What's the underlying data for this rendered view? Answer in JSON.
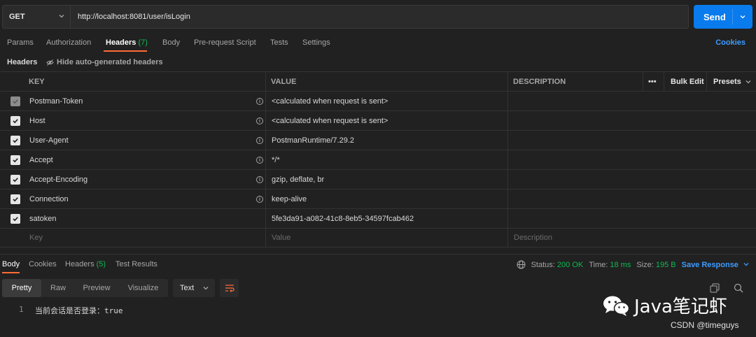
{
  "request": {
    "method": "GET",
    "url": "http://localhost:8081/user/isLogin",
    "send_label": "Send"
  },
  "request_tabs": [
    {
      "label": "Params"
    },
    {
      "label": "Authorization"
    },
    {
      "label": "Headers",
      "count": "(7)"
    },
    {
      "label": "Body"
    },
    {
      "label": "Pre-request Script"
    },
    {
      "label": "Tests"
    },
    {
      "label": "Settings"
    }
  ],
  "cookies_label": "Cookies",
  "headers_section": {
    "title": "Headers",
    "hide_auto_label": "Hide auto-generated headers"
  },
  "table": {
    "col_key": "KEY",
    "col_value": "VALUE",
    "col_description": "DESCRIPTION",
    "more_label": "•••",
    "bulk_edit_label": "Bulk Edit",
    "presets_label": "Presets",
    "rows": [
      {
        "key": "Postman-Token",
        "value": "<calculated when request is sent>"
      },
      {
        "key": "Host",
        "value": "<calculated when request is sent>"
      },
      {
        "key": "User-Agent",
        "value": "PostmanRuntime/7.29.2"
      },
      {
        "key": "Accept",
        "value": "*/*"
      },
      {
        "key": "Accept-Encoding",
        "value": "gzip, deflate, br"
      },
      {
        "key": "Connection",
        "value": "keep-alive"
      },
      {
        "key": "satoken",
        "value": "5fe3da91-a082-41c8-8eb5-34597fcab462"
      }
    ],
    "placeholder_key": "Key",
    "placeholder_value": "Value",
    "placeholder_description": "Description"
  },
  "response_tabs": [
    {
      "label": "Body"
    },
    {
      "label": "Cookies"
    },
    {
      "label": "Headers",
      "count": "(5)"
    },
    {
      "label": "Test Results"
    }
  ],
  "response_status": {
    "status_label": "Status:",
    "status_value": "200 OK",
    "time_label": "Time:",
    "time_value": "18 ms",
    "size_label": "Size:",
    "size_value": "195 B",
    "save_label": "Save Response"
  },
  "format_buttons": [
    "Pretty",
    "Raw",
    "Preview",
    "Visualize"
  ],
  "text_select": "Text",
  "body_lines": [
    {
      "num": "1",
      "text": "当前会话是否登录：true"
    }
  ],
  "watermark": {
    "brand": "Java笔记虾",
    "csdn": "CSDN @timeguys"
  },
  "colors": {
    "accent": "#ff6c37",
    "send": "#097bed",
    "success": "#0cbb52",
    "link": "#3d9bff"
  }
}
